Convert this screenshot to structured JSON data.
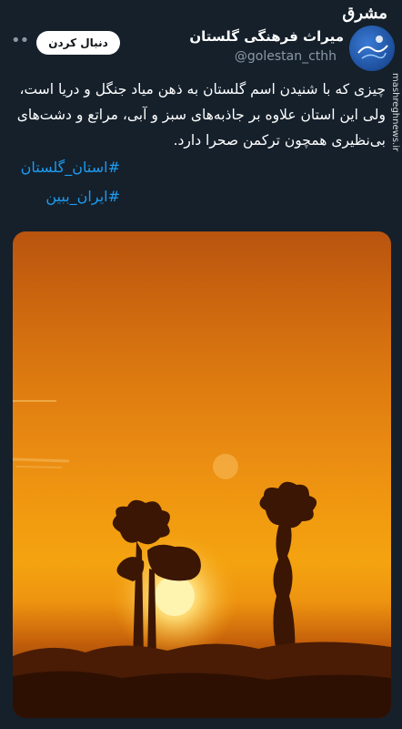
{
  "header": {
    "follow_label": "دنبال کردن",
    "more_label": "••",
    "display_name": "میراث فرهنگی گلستان",
    "handle": "@golestan_cthh",
    "avatar_icon": "golestan-province-logo"
  },
  "watermark": {
    "brand": "مشرق",
    "site": "mashreghnews.ir"
  },
  "tweet": {
    "text": "چیزی که با شنیدن اسم گلستان به ذهن میاد جنگل و دریا است، ولی این استان علاوه بر جاذبه‌های سبز و آبی، مراتع و دشت‌های بی‌نظیری همچون ترکمن صحرا دارد.",
    "hashtags": [
      "#استان_گلستان",
      "#ایران_ببین"
    ]
  },
  "media": {
    "description_icon": "sunset-photo",
    "colors": {
      "sky_top": "#b8540f",
      "sky_mid": "#f19a10",
      "sun": "#fff3b0",
      "ground": "#5c2606"
    }
  },
  "colors": {
    "background": "#15202b",
    "accent": "#1d9bf0",
    "secondary_text": "#8b98a5"
  }
}
